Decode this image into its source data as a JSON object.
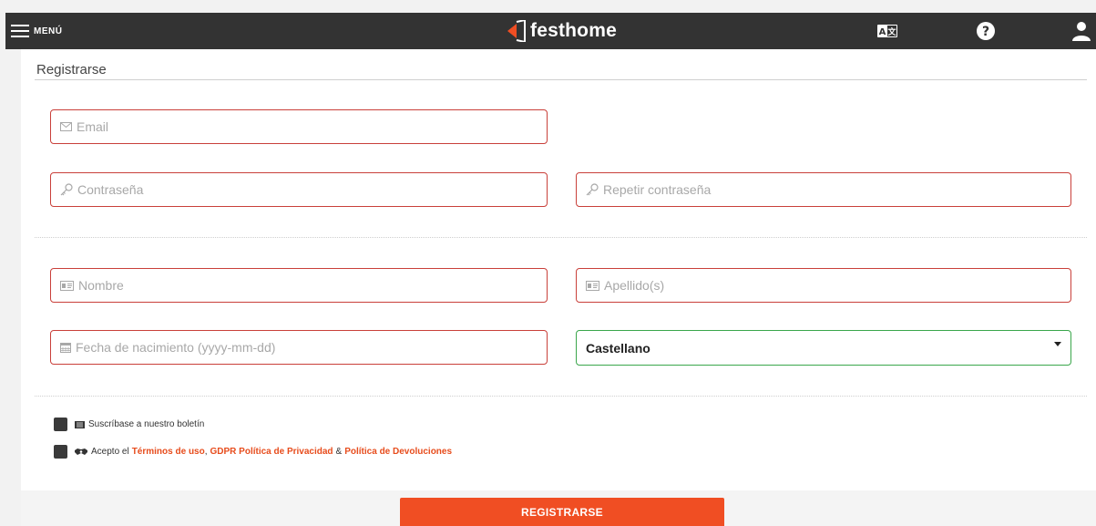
{
  "topbar": {
    "menu_label": "MENÚ",
    "logo_text": "festhome",
    "icons": [
      "hamburger-icon",
      "festhome-logo-icon",
      "language-icon",
      "help-icon",
      "user-icon"
    ]
  },
  "form": {
    "title": "Registrarse",
    "email_placeholder": "Email",
    "password_placeholder": "Contraseña",
    "repeat_password_placeholder": "Repetir contraseña",
    "first_name_placeholder": "Nombre",
    "last_name_placeholder": "Apellido(s)",
    "birthdate_placeholder": "Fecha de nacimiento (yyyy-mm-dd)",
    "language_selected": "Castellano",
    "newsletter_label": "Suscríbase a nuestro boletín",
    "terms_prefix": "Acepto el",
    "terms_link": "Términos de uso",
    "terms_sep1": ",",
    "privacy_link": "GDPR Política de Privacidad",
    "terms_amp": "&",
    "returns_link": "Política de Devoluciones",
    "submit_label": "REGISTRARSE"
  },
  "colors": {
    "topbar": "#333333",
    "accent": "#f04e23",
    "field_border_invalid": "#c9403a",
    "field_border_valid": "#3aa64b",
    "link": "#e74c1c"
  }
}
